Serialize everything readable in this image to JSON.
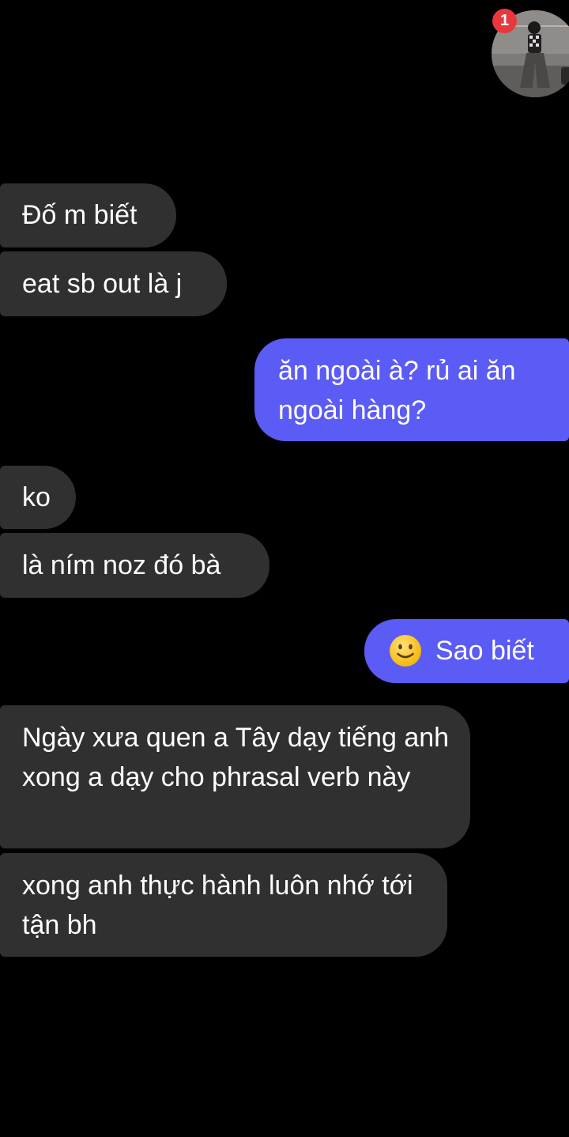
{
  "chat_head": {
    "unread_count": "1"
  },
  "messages": [
    {
      "sender": "contact",
      "text": "Đố m biết"
    },
    {
      "sender": "contact",
      "text": "eat sb out là j"
    },
    {
      "sender": "me",
      "text": "ăn ngoài à? rủ ai ăn ngoài hàng?"
    },
    {
      "sender": "contact",
      "text": "ko"
    },
    {
      "sender": "contact",
      "text": "là ním noz đó bà"
    },
    {
      "sender": "me",
      "emoji": "slightly-smiling-face",
      "text": "Sao biết"
    },
    {
      "sender": "contact",
      "text": "Ngày xưa quen a Tây dạy tiếng anh xong a dạy cho phrasal verb này"
    },
    {
      "sender": "contact",
      "text": "xong anh thực hành luôn nhớ tới tận bh"
    }
  ],
  "colors": {
    "background": "#000000",
    "incoming_bubble": "#303030",
    "outgoing_bubble": "#5b5bf5",
    "badge": "#e8383d",
    "text": "#ffffff"
  }
}
